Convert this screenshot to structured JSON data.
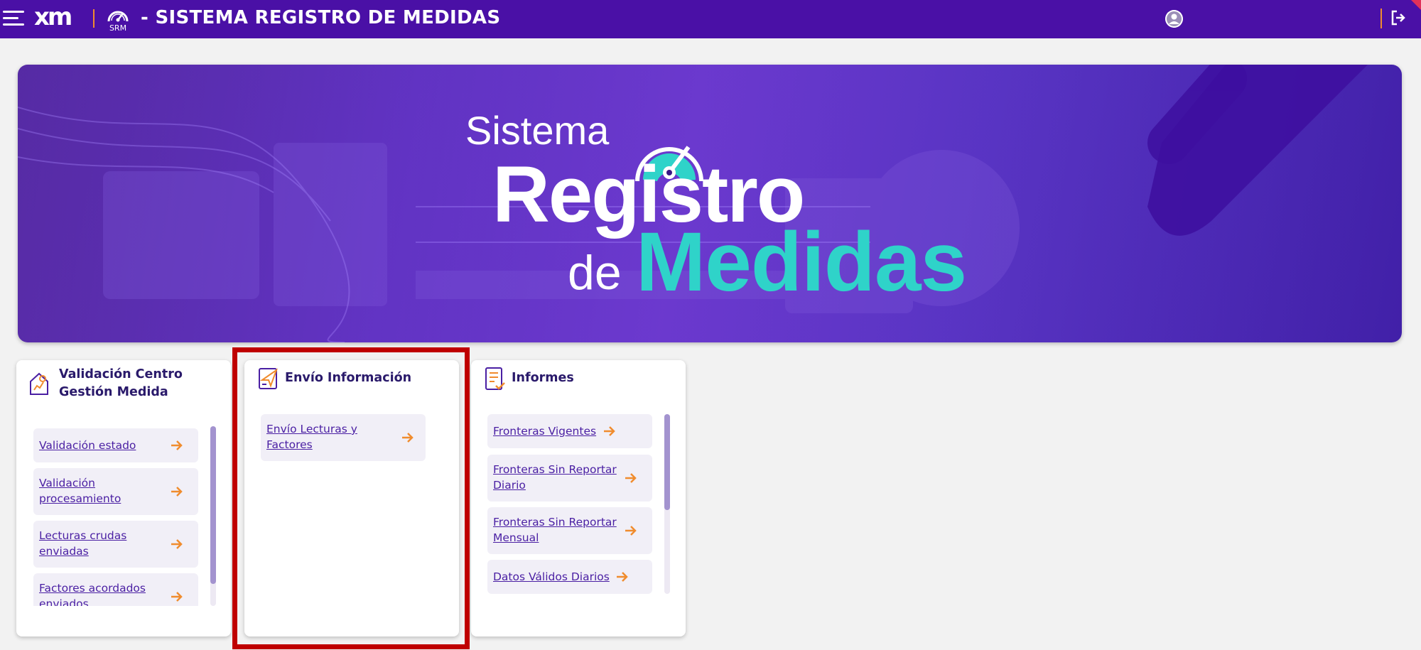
{
  "header": {
    "logo_text": "xm",
    "srm_label": "SRM",
    "title": "- SISTEMA REGISTRO DE MEDIDAS"
  },
  "banner": {
    "line1": "Sistema",
    "line2": "Registro",
    "line3a": "de",
    "line3b": "Medidas"
  },
  "cards": [
    {
      "title": "Validación Centro Gestión Medida",
      "icon": "house-chart-icon",
      "items": [
        "Validación estado",
        "Validación procesamiento",
        "Lecturas crudas enviadas",
        "Factores acordados enviados"
      ]
    },
    {
      "title": "Envío Información",
      "icon": "send-document-icon",
      "items": [
        "Envío Lecturas y Factores"
      ]
    },
    {
      "title": "Informes",
      "icon": "report-check-icon",
      "items": [
        "Fronteras Vigentes",
        "Fronteras Sin Reportar Diario",
        "Fronteras Sin Reportar Mensual",
        "Datos Válidos Diarios"
      ]
    }
  ],
  "colors": {
    "topbar": "#4a10a6",
    "accent_orange": "#f08c2e",
    "teal": "#2fd3c9",
    "link": "#4a1fa3",
    "highlight": "#bf0000"
  }
}
